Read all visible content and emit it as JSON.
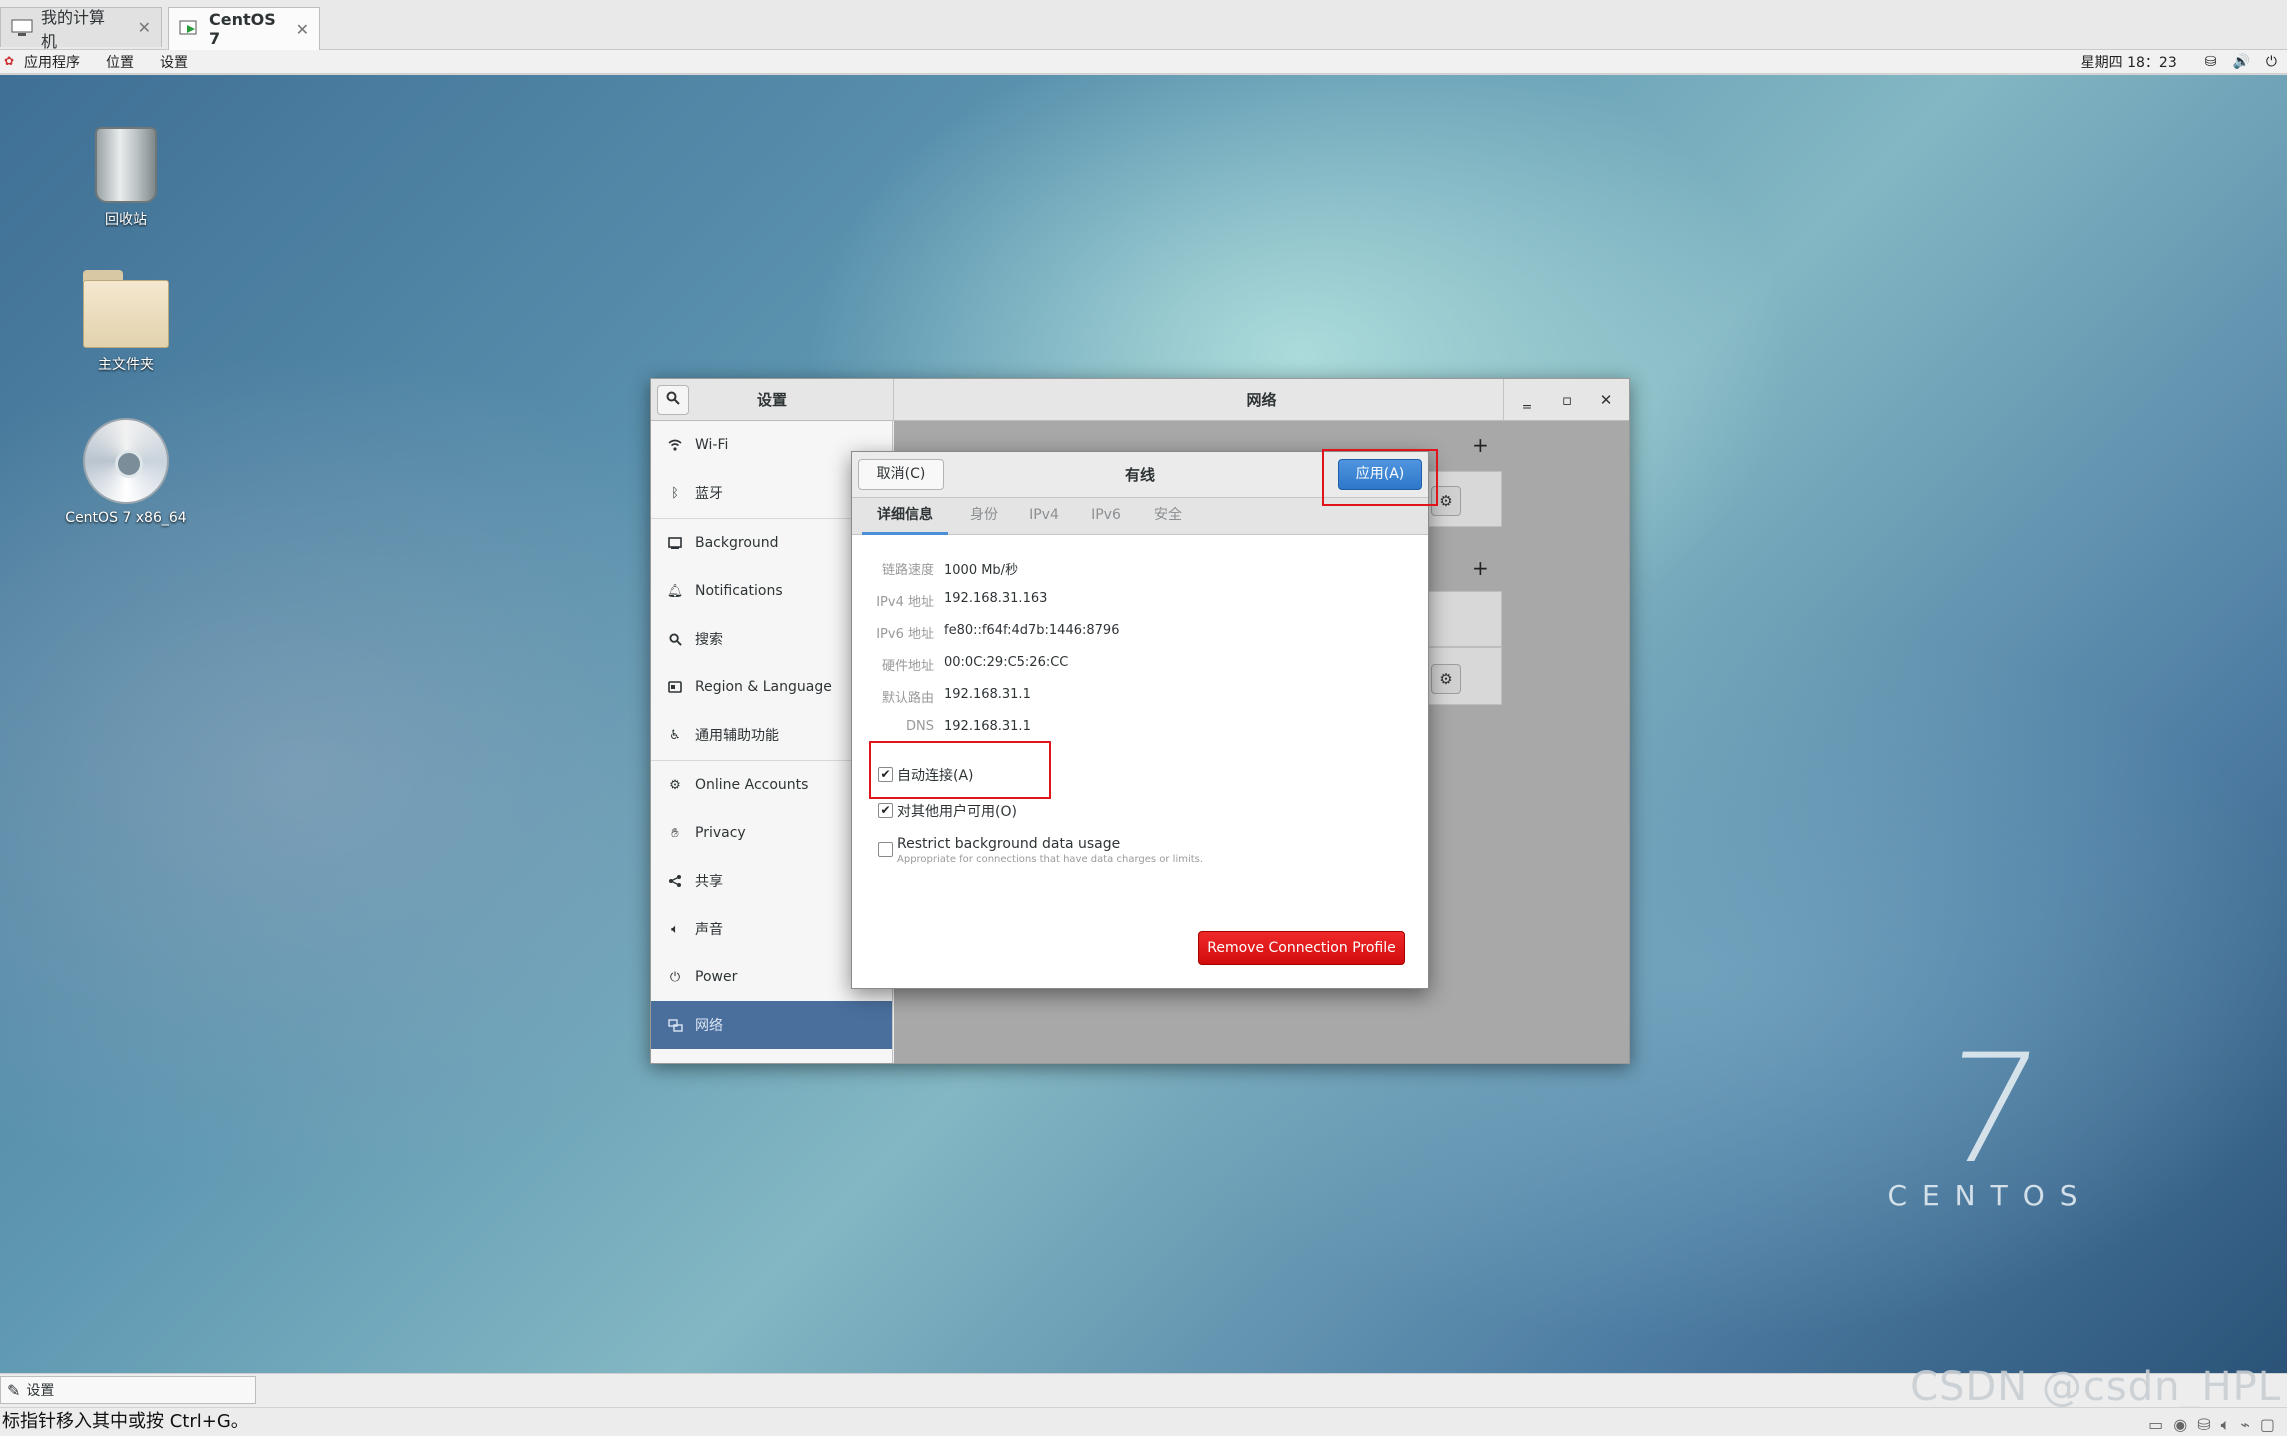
{
  "vm_tabs": [
    {
      "label": "我的计算机",
      "icon": "computer-icon"
    },
    {
      "label": "CentOS 7",
      "icon": "vm-icon"
    }
  ],
  "top_bar": {
    "menus": [
      "应用程序",
      "位置",
      "设置"
    ],
    "clock": "星期四 18：23"
  },
  "desktop_icons": [
    {
      "label": "回收站"
    },
    {
      "label": "主文件夹"
    },
    {
      "label": "CentOS 7 x86_64"
    }
  ],
  "centos_logo": {
    "number": "7",
    "word": "CENTOS"
  },
  "settings_window": {
    "left_title": "设置",
    "right_title": "网络",
    "sidebar": [
      {
        "label": "Wi-Fi",
        "icon": "wifi-icon"
      },
      {
        "label": "蓝牙",
        "icon": "bluetooth-icon"
      },
      {
        "label": "Background",
        "icon": "background-icon"
      },
      {
        "label": "Notifications",
        "icon": "bell-icon"
      },
      {
        "label": "搜索",
        "icon": "search-icon"
      },
      {
        "label": "Region & Language",
        "icon": "region-icon"
      },
      {
        "label": "通用辅助功能",
        "icon": "accessibility-icon"
      },
      {
        "label": "Online Accounts",
        "icon": "online-accounts-icon"
      },
      {
        "label": "Privacy",
        "icon": "privacy-hand-icon"
      },
      {
        "label": "共享",
        "icon": "share-icon"
      },
      {
        "label": "声音",
        "icon": "speaker-icon"
      },
      {
        "label": "Power",
        "icon": "power-icon"
      },
      {
        "label": "网络",
        "icon": "network-icon"
      }
    ]
  },
  "dialog": {
    "title": "有线",
    "cancel_label": "取消(C)",
    "apply_label": "应用(A)",
    "tabs": [
      "详细信息",
      "身份",
      "IPv4",
      "IPv6",
      "安全"
    ],
    "details": [
      {
        "key": "链路速度",
        "value": "1000 Mb/秒"
      },
      {
        "key": "IPv4 地址",
        "value": "192.168.31.163"
      },
      {
        "key": "IPv6 地址",
        "value": "fe80::f64f:4d7b:1446:8796"
      },
      {
        "key": "硬件地址",
        "value": "00:0C:29:C5:26:CC"
      },
      {
        "key": "默认路由",
        "value": "192.168.31.1"
      },
      {
        "key": "DNS",
        "value": "192.168.31.1"
      }
    ],
    "auto_connect": {
      "label": "自动连接(A)",
      "checked": true
    },
    "all_users": {
      "label": "对其他用户可用(O)",
      "checked": true
    },
    "restrict": {
      "label": "Restrict background data usage",
      "sublabel": "Appropriate for connections that have data charges or limits.",
      "checked": false
    },
    "remove_label": "Remove Connection Profile"
  },
  "taskbar": {
    "item_label": "设置",
    "watermark": "CSDN @csdn_HPL"
  },
  "status_bar": {
    "text": "标指针移入其中或按 Ctrl+G。"
  },
  "colors": {
    "accent": "#4a90d9",
    "selected": "#4a6f9d",
    "danger": "#e0141b"
  }
}
